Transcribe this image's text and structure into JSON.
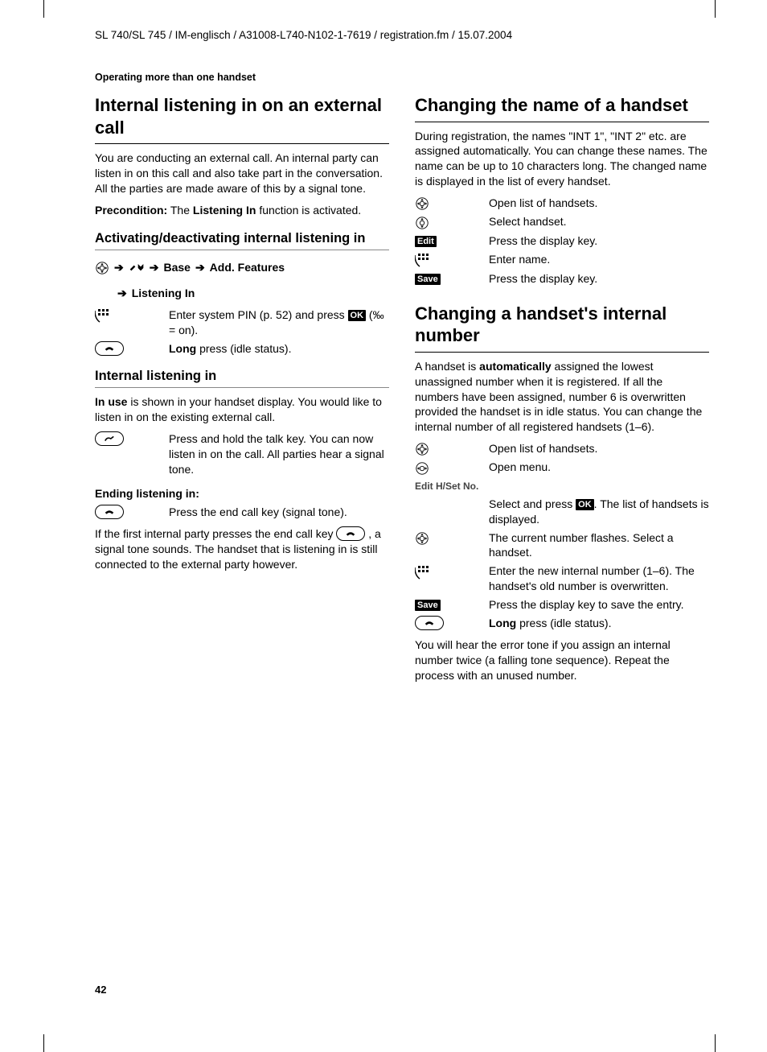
{
  "header": "SL 740/SL 745 / IM-englisch / A31008-L740-N102-1-7619 / registration.fm / 15.07.2004",
  "section_title": "Operating more than one handset",
  "page_number": "42",
  "left": {
    "h1": "Internal listening in on an external call",
    "p1": "You are conducting an external call. An internal party can listen in on this call and also take part in the conversation. All the parties are made aware of this by a signal tone.",
    "precond_label": "Precondition:",
    "precond_text1": " The ",
    "precond_b": "Listening In",
    "precond_text2": " function is activated.",
    "h2": "Activating/deactivating internal listening in",
    "nav_base": "Base",
    "nav_addl": "Add. Features",
    "nav_listening": "Listening In",
    "row1a": "Enter system PIN (p. 52) and press ",
    "row1_ok": "OK",
    "row1b": " (‰ = on).",
    "row2_long": "Long",
    "row2_rest": " press (idle status).",
    "h3": "Internal listening in",
    "inuse": "In use",
    "p2": " is shown in your handset display. You would like to listen in on the existing external call.",
    "row3": "Press and hold the talk key. You can now listen in on the call. All parties hear a signal tone.",
    "h4": "Ending listening in:",
    "row4": "Press the end call key (signal tone).",
    "p3a": "If the first internal party presses the end call key ",
    "p3b": " , a signal tone sounds. The handset that is listening in is still connected to the external party however."
  },
  "right": {
    "h1": "Changing the name of a handset",
    "p1": "During registration, the names \"INT 1\", \"INT 2\" etc. are assigned automatically. You can change these names. The name can be up to 10 characters long. The changed name is displayed in the list of every handset.",
    "r1": "Open list of handsets.",
    "r2": "Select handset.",
    "edit": "Edit",
    "r3": "Press the display key.",
    "r4": "Enter name.",
    "save": "Save",
    "r5": "Press the display key.",
    "h2": "Changing a handset's internal number",
    "p2a": "A handset is ",
    "p2b": "automatically",
    "p2c": " assigned the lowest unassigned number when it is registered. If all the numbers have been assigned, number 6 is overwritten provided the handset is in idle status. You can change the internal number of all registered handsets (1–6).",
    "r6": "Open list of handsets.",
    "r7": "Open menu.",
    "edit_hset": "Edit H/Set No.",
    "r8a": "Select and press ",
    "r8_ok": "OK",
    "r8b": ". The list of handsets is displayed.",
    "r9": "The current number flashes. Select a handset.",
    "r10": "Enter the new internal number (1–6). The handset's old number is overwritten.",
    "r11": "Press the display key to save the entry.",
    "r12_long": "Long",
    "r12_rest": " press (idle status).",
    "p3": "You will hear the error tone if you assign an internal number twice (a falling tone sequence). Repeat the process with an unused number."
  }
}
